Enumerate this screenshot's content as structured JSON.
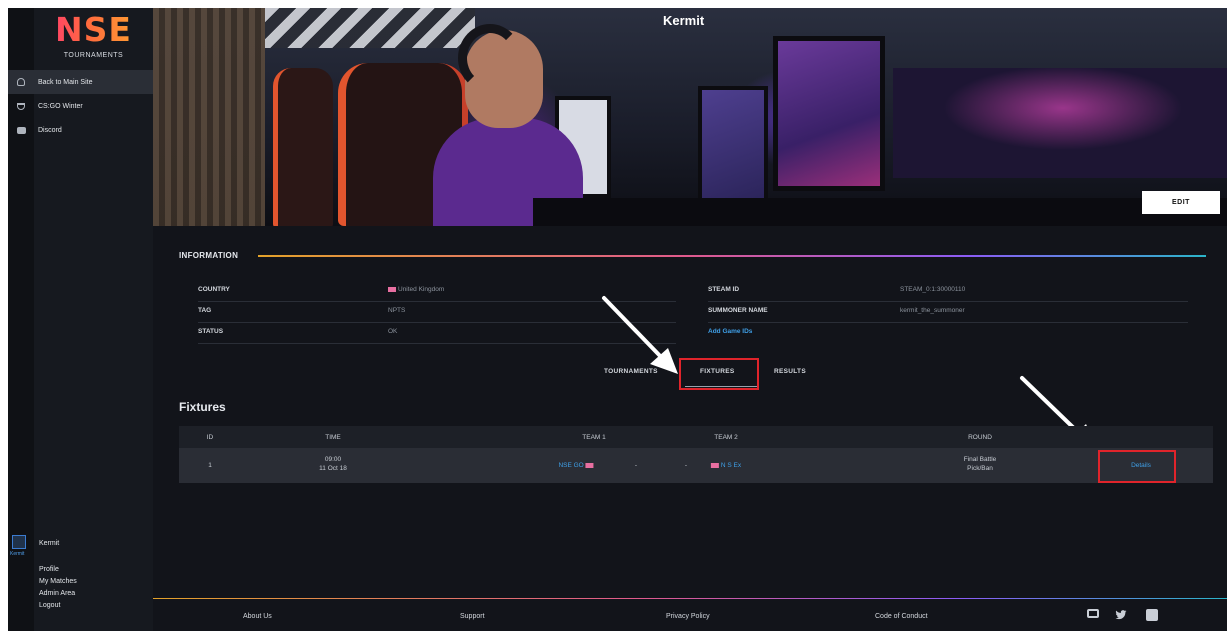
{
  "sidebar": {
    "logo": "NSE",
    "logo_sub": "TOURNAMENTS",
    "items": [
      {
        "label": "Back to Main Site",
        "icon": "home-icon"
      },
      {
        "label": "CS:GO Winter",
        "icon": "trophy-icon"
      },
      {
        "label": "Discord",
        "icon": "discord-icon"
      }
    ],
    "user": {
      "name": "Kermit",
      "avatar_caption": "Kermit",
      "links": [
        "Profile",
        "My Matches",
        "Admin Area",
        "Logout"
      ]
    }
  },
  "banner": {
    "player_name": "Kermit",
    "edit_label": "EDIT"
  },
  "information": {
    "title": "INFORMATION",
    "left": [
      {
        "key": "COUNTRY",
        "value": "United Kingdom"
      },
      {
        "key": "TAG",
        "value": "NPTS"
      },
      {
        "key": "STATUS",
        "value": "OK"
      }
    ],
    "right": [
      {
        "key": "STEAM ID",
        "value": "STEAM_0:1:30000110"
      },
      {
        "key": "SUMMONER NAME",
        "value": "kermit_the_summoner"
      },
      {
        "key": "",
        "value": "Add Game IDs"
      }
    ]
  },
  "tabs": [
    "TOURNAMENTS",
    "FIXTURES",
    "RESULTS"
  ],
  "fixtures": {
    "title": "Fixtures",
    "columns": [
      "ID",
      "TIME",
      "TEAM 1",
      "TEAM 2",
      "ROUND"
    ],
    "rows": [
      {
        "id": "1",
        "time": "09:00",
        "date": "11 Oct 18",
        "team1": "NSE GO",
        "separator": "-",
        "separator2": "-",
        "team2": "N S Ex",
        "round": "Final Battle",
        "round_sub": "Pick/Ban",
        "action": "Details"
      }
    ]
  },
  "footer": {
    "links": [
      "About Us",
      "Support",
      "Privacy Policy",
      "Code of Conduct"
    ],
    "social": [
      "monitor-icon",
      "twitter-icon",
      "facebook-icon"
    ]
  },
  "colors": {
    "highlight": "#e0242b",
    "link": "#3fa0e8"
  }
}
